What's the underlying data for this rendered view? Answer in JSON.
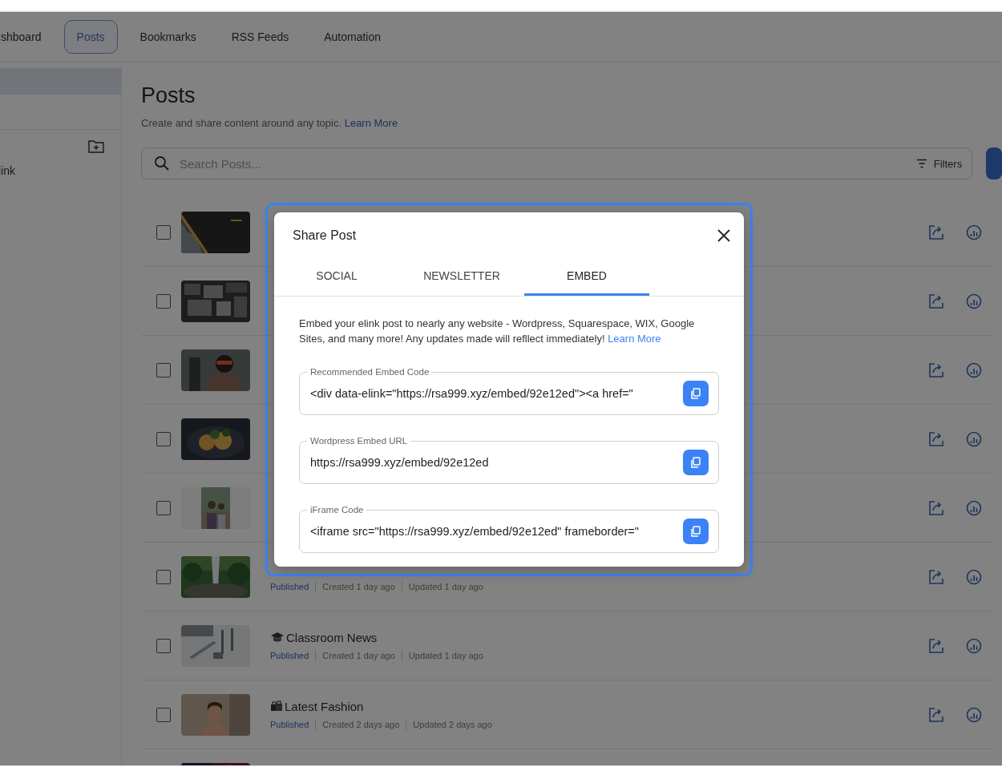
{
  "nav": {
    "tabs": [
      {
        "label": "shboard",
        "selected": false
      },
      {
        "label": "Posts",
        "selected": true
      },
      {
        "label": "Bookmarks",
        "selected": false
      },
      {
        "label": "RSS Feeds",
        "selected": false
      },
      {
        "label": "Automation",
        "selected": false
      }
    ]
  },
  "sidebar": {
    "items": [
      {
        "selected": true
      }
    ],
    "folder_items": [
      {
        "label": "link",
        "selected": false
      }
    ]
  },
  "page": {
    "title": "Posts",
    "subtitle": "Create and share content around any topic.",
    "subtitle_link": "Learn More",
    "search": {
      "placeholder": "Search Posts..."
    },
    "filters_label": "Filters"
  },
  "posts": [
    {
      "kind": "covered",
      "checked": false
    },
    {
      "kind": "covered",
      "checked": false
    },
    {
      "kind": "covered",
      "checked": false
    },
    {
      "kind": "covered",
      "checked": false
    },
    {
      "kind": "covered",
      "checked": false
    },
    {
      "kind": "meta",
      "checked": false,
      "status": "Published",
      "created": "Created 1 day ago",
      "updated": "Updated 1 day ago"
    },
    {
      "kind": "full",
      "checked": false,
      "title": "Classroom News",
      "status": "Published",
      "created": "Created 1 day ago",
      "updated": "Updated 1 day ago"
    },
    {
      "kind": "full",
      "checked": false,
      "title": "Latest Fashion",
      "status": "Published",
      "created": "Created 2 days ago",
      "updated": "Updated 2 days ago"
    },
    {
      "kind": "cut"
    }
  ],
  "dialog": {
    "title": "Share Post",
    "tabs": [
      {
        "label": "SOCIAL",
        "selected": false
      },
      {
        "label": "NEWSLETTER",
        "selected": false
      },
      {
        "label": "EMBED",
        "selected": true
      }
    ],
    "description": "Embed your elink post to nearly any website - Wordpress, Squarespace, WIX, Google Sites, and many more! Any updates made will refllect immediately!",
    "description_link": "Learn More",
    "fields": [
      {
        "label": "Recommended Embed Code",
        "value": "<div data-elink=\"https://rsa999.xyz/embed/92e12ed\"><a href=\""
      },
      {
        "label": "Wordpress Embed URL",
        "value": "https://rsa999.xyz/embed/92e12ed"
      },
      {
        "label": "iFrame Code",
        "value": "<iframe src=\"https://rsa999.xyz/embed/92e12ed\" frameborder=\""
      }
    ]
  }
}
